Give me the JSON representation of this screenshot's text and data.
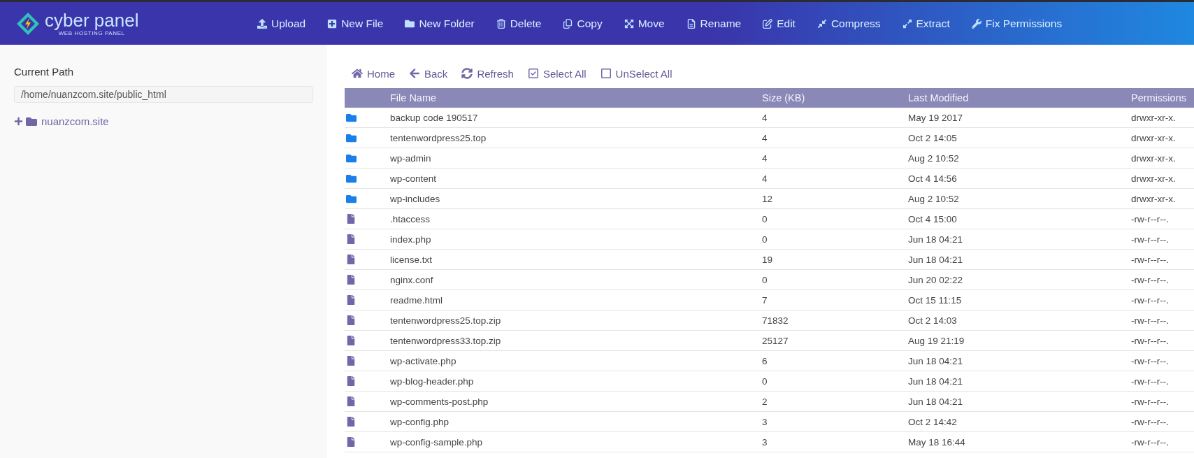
{
  "header": {
    "logo": {
      "name": "cyber panel",
      "tagline": "WEB HOSTING PANEL"
    },
    "actions": [
      "Upload",
      "New File",
      "New Folder",
      "Delete",
      "Copy",
      "Move",
      "Rename",
      "Edit",
      "Compress",
      "Extract",
      "Fix Permissions"
    ]
  },
  "sidebar": {
    "title": "Current Path",
    "path": "/home/nuanzcom.site/public_html",
    "tree": [
      {
        "label": "nuanzcom.site",
        "expanded": false
      }
    ]
  },
  "toolbar": [
    "Home",
    "Back",
    "Refresh",
    "Select All",
    "UnSelect All"
  ],
  "table": {
    "columns": [
      "File Name",
      "Size (KB)",
      "Last Modified",
      "Permissions"
    ],
    "rows": [
      {
        "kind": "folder",
        "name": "backup code 190517",
        "size": "4",
        "modified": "May 19 2017",
        "permissions": "drwxr-xr-x."
      },
      {
        "kind": "folder",
        "name": "tentenwordpress25.top",
        "size": "4",
        "modified": "Oct 2 14:05",
        "permissions": "drwxr-xr-x."
      },
      {
        "kind": "folder",
        "name": "wp-admin",
        "size": "4",
        "modified": "Aug 2 10:52",
        "permissions": "drwxr-xr-x."
      },
      {
        "kind": "folder",
        "name": "wp-content",
        "size": "4",
        "modified": "Oct 4 14:56",
        "permissions": "drwxr-xr-x."
      },
      {
        "kind": "folder",
        "name": "wp-includes",
        "size": "12",
        "modified": "Aug 2 10:52",
        "permissions": "drwxr-xr-x."
      },
      {
        "kind": "file",
        "name": ".htaccess",
        "size": "0",
        "modified": "Oct 4 15:00",
        "permissions": "-rw-r--r--."
      },
      {
        "kind": "file",
        "name": "index.php",
        "size": "0",
        "modified": "Jun 18 04:21",
        "permissions": "-rw-r--r--."
      },
      {
        "kind": "file",
        "name": "license.txt",
        "size": "19",
        "modified": "Jun 18 04:21",
        "permissions": "-rw-r--r--."
      },
      {
        "kind": "file",
        "name": "nginx.conf",
        "size": "0",
        "modified": "Jun 20 02:22",
        "permissions": "-rw-r--r--."
      },
      {
        "kind": "file",
        "name": "readme.html",
        "size": "7",
        "modified": "Oct 15 11:15",
        "permissions": "-rw-r--r--."
      },
      {
        "kind": "file",
        "name": "tentenwordpress25.top.zip",
        "size": "71832",
        "modified": "Oct 2 14:03",
        "permissions": "-rw-r--r--."
      },
      {
        "kind": "file",
        "name": "tentenwordpress33.top.zip",
        "size": "25127",
        "modified": "Aug 19 21:19",
        "permissions": "-rw-r--r--."
      },
      {
        "kind": "file",
        "name": "wp-activate.php",
        "size": "6",
        "modified": "Jun 18 04:21",
        "permissions": "-rw-r--r--."
      },
      {
        "kind": "file",
        "name": "wp-blog-header.php",
        "size": "0",
        "modified": "Jun 18 04:21",
        "permissions": "-rw-r--r--."
      },
      {
        "kind": "file",
        "name": "wp-comments-post.php",
        "size": "2",
        "modified": "Jun 18 04:21",
        "permissions": "-rw-r--r--."
      },
      {
        "kind": "file",
        "name": "wp-config.php",
        "size": "3",
        "modified": "Oct 2 14:42",
        "permissions": "-rw-r--r--."
      },
      {
        "kind": "file",
        "name": "wp-config-sample.php",
        "size": "3",
        "modified": "May 18 16:44",
        "permissions": "-rw-r--r--."
      }
    ]
  }
}
